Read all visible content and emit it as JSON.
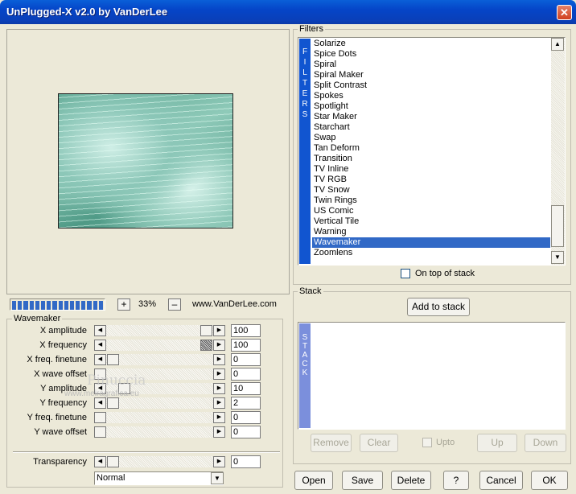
{
  "window": {
    "title": "UnPlugged-X v2.0 by VanDerLee",
    "close_glyph": "✕"
  },
  "preview": {
    "zoom_in": "+",
    "zoom_out": "–",
    "zoom": "33%",
    "website": "www.VanDerLee.com"
  },
  "progress": {
    "fraction": 1.0
  },
  "filters": {
    "label": "Filters",
    "bar_letters": [
      "F",
      "I",
      "L",
      "T",
      "E",
      "R",
      "S"
    ],
    "items": [
      "Solarize",
      "Spice Dots",
      "Spiral",
      "Spiral Maker",
      "Split Contrast",
      "Spokes",
      "Spotlight",
      "Star Maker",
      "Starchart",
      "Swap",
      "Tan Deform",
      "Transition",
      "TV Inline",
      "TV RGB",
      "TV Snow",
      "Twin Rings",
      "US Comic",
      "Vertical Tile",
      "Warning",
      "Wavemaker",
      "Zoomlens"
    ],
    "selected": "Wavemaker",
    "on_top_label": "On top of stack"
  },
  "stack": {
    "label": "Stack",
    "add_label": "Add to stack",
    "bar_letters": [
      "S",
      "T",
      "A",
      "C",
      "K"
    ],
    "remove": "Remove",
    "clear": "Clear",
    "upto": "Upto",
    "up": "Up",
    "down": "Down"
  },
  "wavemaker": {
    "label": "Wavemaker",
    "params": [
      {
        "label": "X amplitude",
        "value": "100"
      },
      {
        "label": "X frequency",
        "value": "100"
      },
      {
        "label": "X freq. finetune",
        "value": "0"
      },
      {
        "label": "X wave offset",
        "value": "0"
      },
      {
        "label": "Y amplitude",
        "value": "10"
      },
      {
        "label": "Y frequency",
        "value": "2"
      },
      {
        "label": "Y freq. finetune",
        "value": "0"
      },
      {
        "label": "Y wave offset",
        "value": "0"
      }
    ],
    "transparency_label": "Transparency",
    "transparency_value": "0",
    "blend_mode": "Normal"
  },
  "watermark": {
    "line1": "Pinuccia",
    "line2": "www.meiragrafica.eu"
  },
  "buttons": {
    "open": "Open",
    "save": "Save",
    "delete": "Delete",
    "help": "?",
    "cancel": "Cancel",
    "ok": "OK"
  },
  "colors": {
    "titlebar": "#0545c8",
    "selection": "#3169c6",
    "filters_bar": "#1155d0",
    "stack_bar": "#7b8fdc"
  }
}
